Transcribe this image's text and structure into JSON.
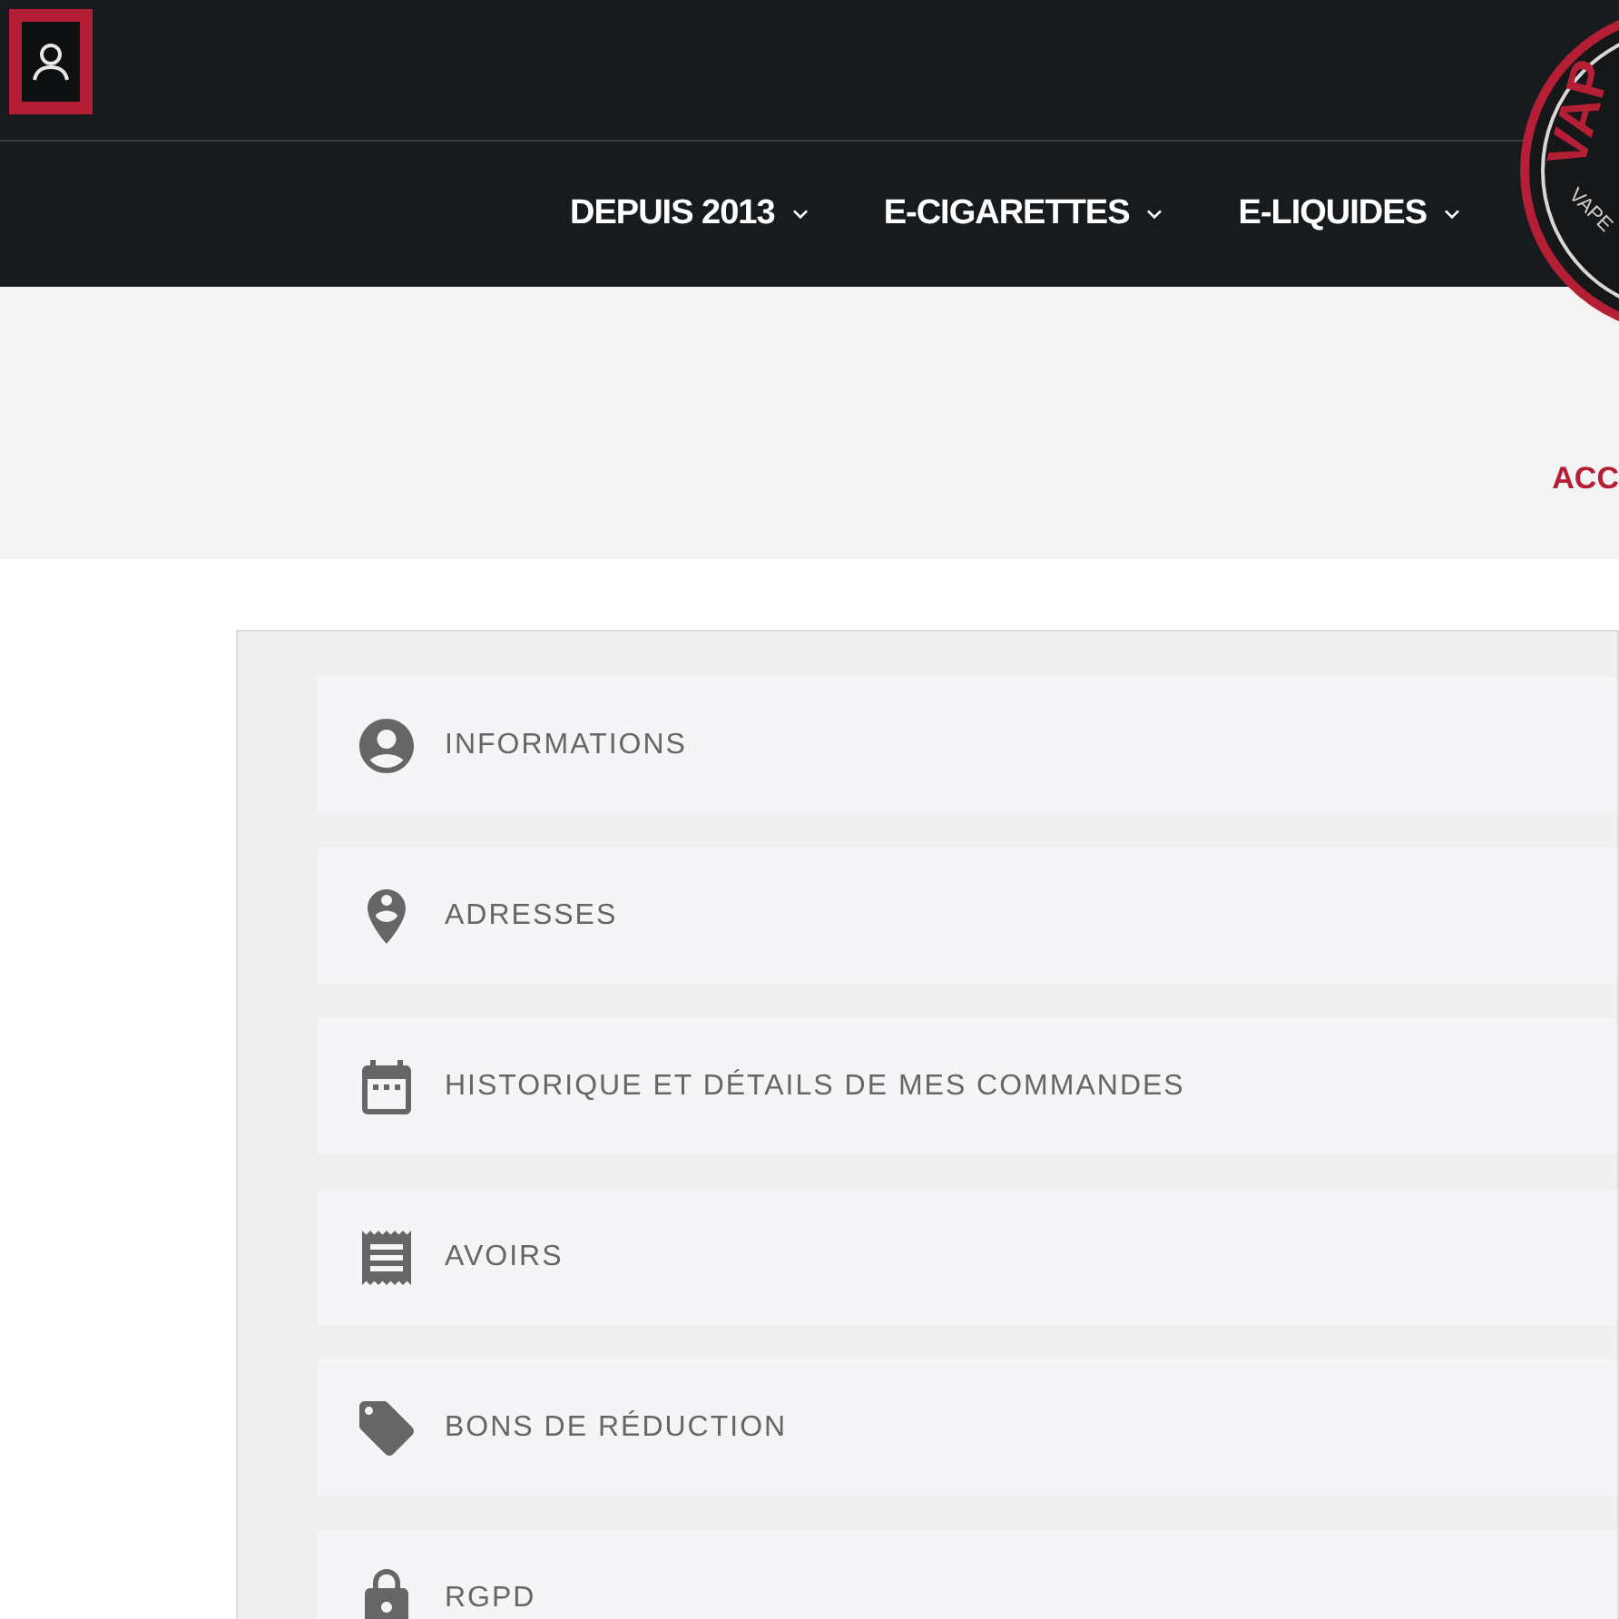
{
  "header": {
    "account_button": {
      "selected": true
    }
  },
  "nav": [
    {
      "label": "DEPUIS 2013"
    },
    {
      "label": "E-CIGARETTES"
    },
    {
      "label": "E-LIQUIDES"
    }
  ],
  "logo": {
    "texts": [
      "VAP",
      "VAPE"
    ]
  },
  "breadcrumb": "ACC",
  "account_links": [
    {
      "label": "INFORMATIONS"
    },
    {
      "label": "ADRESSES"
    },
    {
      "label": "HISTORIQUE ET DÉTAILS DE MES COMMANDES"
    },
    {
      "label": "AVOIRS"
    },
    {
      "label": "BONS DE RÉDUCTION"
    },
    {
      "label": "RGPD"
    }
  ]
}
